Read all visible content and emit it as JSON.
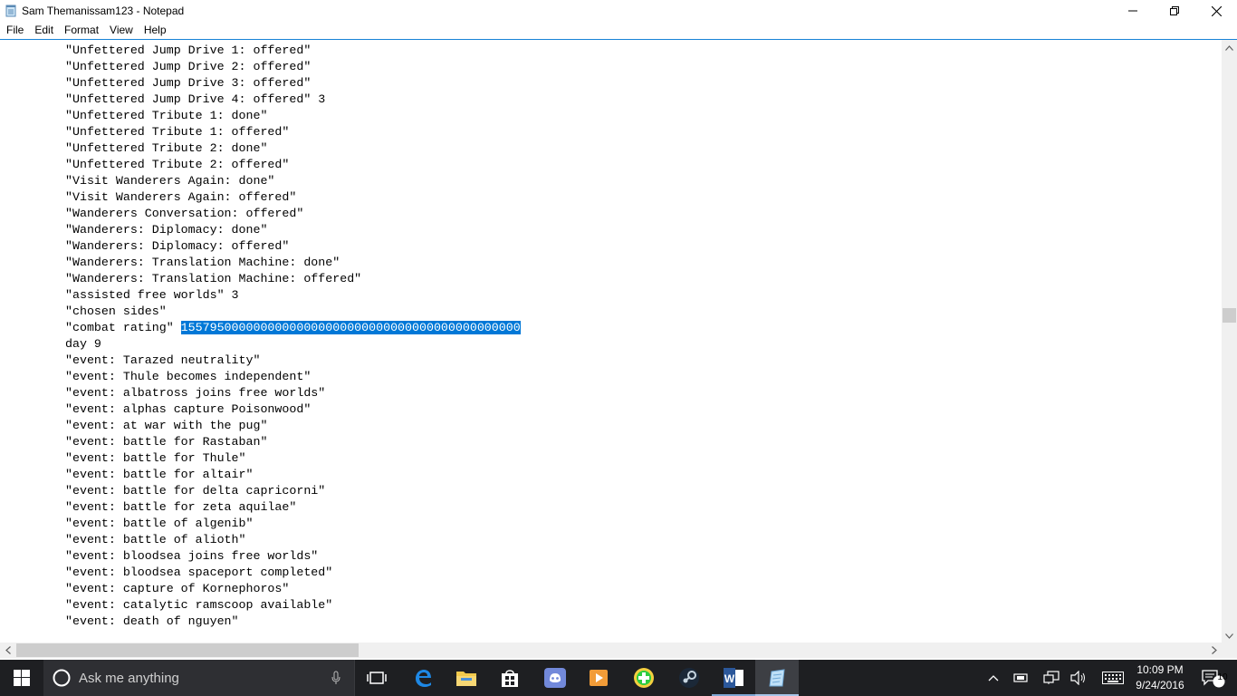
{
  "window": {
    "title": "Sam Themanissam123 - Notepad"
  },
  "menu": [
    "File",
    "Edit",
    "Format",
    "View",
    "Help"
  ],
  "editor": {
    "lines": [
      "\"Unfettered Jump Drive 1: offered\"",
      "\"Unfettered Jump Drive 2: offered\"",
      "\"Unfettered Jump Drive 3: offered\"",
      "\"Unfettered Jump Drive 4: offered\" 3",
      "\"Unfettered Tribute 1: done\"",
      "\"Unfettered Tribute 1: offered\"",
      "\"Unfettered Tribute 2: done\"",
      "\"Unfettered Tribute 2: offered\"",
      "\"Visit Wanderers Again: done\"",
      "\"Visit Wanderers Again: offered\"",
      "\"Wanderers Conversation: offered\"",
      "\"Wanderers: Diplomacy: done\"",
      "\"Wanderers: Diplomacy: offered\"",
      "\"Wanderers: Translation Machine: done\"",
      "\"Wanderers: Translation Machine: offered\"",
      "\"assisted free worlds\" 3",
      "\"chosen sides\"",
      "\"combat rating\" ",
      "day 9",
      "\"event: Tarazed neutrality\"",
      "\"event: Thule becomes independent\"",
      "\"event: albatross joins free worlds\"",
      "\"event: alphas capture Poisonwood\"",
      "\"event: at war with the pug\"",
      "\"event: battle for Rastaban\"",
      "\"event: battle for Thule\"",
      "\"event: battle for altair\"",
      "\"event: battle for delta capricorni\"",
      "\"event: battle for zeta aquilae\"",
      "\"event: battle of algenib\"",
      "\"event: battle of alioth\"",
      "\"event: bloodsea joins free worlds\"",
      "\"event: bloodsea spaceport completed\"",
      "\"event: capture of Kornephoros\"",
      "\"event: catalytic ramscoop available\"",
      "\"event: death of nguyen\""
    ],
    "selected_index": 17,
    "selected_text": "15579500000000000000000000000000000000000000000"
  },
  "scroll": {
    "vertical_position": 0.45,
    "horizontal_fraction_visible": 0.28
  },
  "taskbar": {
    "search_placeholder": "Ask me anything",
    "apps": [
      "task-view",
      "edge",
      "file-explorer",
      "store",
      "discord",
      "media-player",
      "plus-app",
      "steam",
      "word",
      "notepad"
    ],
    "active_app": "notepad",
    "clock_time": "10:09 PM",
    "clock_date": "9/24/2016",
    "notification_count": "10"
  },
  "colors": {
    "selection": "#0078d7",
    "taskbar": "#1e1f22",
    "accent_border": "#1883d7"
  }
}
